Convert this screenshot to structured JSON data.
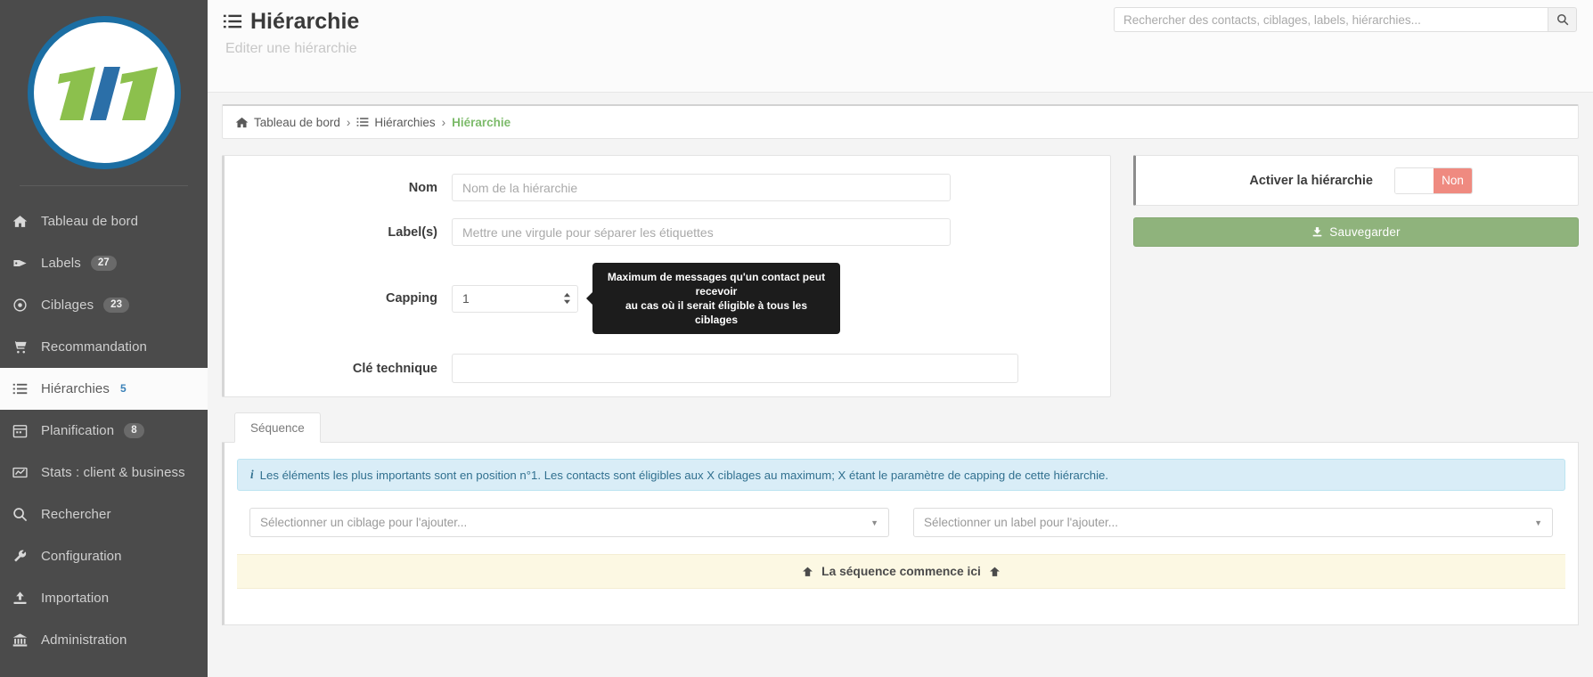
{
  "sidebar": {
    "logo": {
      "alt": "1|1 logo",
      "green": "#8cc04d",
      "blue": "#2b6fa8"
    },
    "items": [
      {
        "label": "Tableau de bord",
        "icon": "home-icon",
        "badge": null,
        "active": false
      },
      {
        "label": "Labels",
        "icon": "tag-icon",
        "badge": "27",
        "active": false
      },
      {
        "label": "Ciblages",
        "icon": "target-icon",
        "badge": "23",
        "active": false
      },
      {
        "label": "Recommandation",
        "icon": "cart-icon",
        "badge": null,
        "active": false
      },
      {
        "label": "Hiérarchies",
        "icon": "list-icon",
        "badge": "5",
        "active": true
      },
      {
        "label": "Planification",
        "icon": "calendar-icon",
        "badge": "8",
        "active": false
      },
      {
        "label": "Stats : client & business",
        "icon": "chart-icon",
        "badge": null,
        "active": false
      },
      {
        "label": "Rechercher",
        "icon": "search-icon",
        "badge": null,
        "active": false
      },
      {
        "label": "Configuration",
        "icon": "wrench-icon",
        "badge": null,
        "active": false
      },
      {
        "label": "Importation",
        "icon": "upload-icon",
        "badge": null,
        "active": false
      },
      {
        "label": "Administration",
        "icon": "bank-icon",
        "badge": null,
        "active": false
      }
    ]
  },
  "header": {
    "title": "Hiérarchie",
    "subtitle": "Editer une hiérarchie",
    "search_placeholder": "Rechercher des contacts, ciblages, labels, hiérarchies...",
    "search_value": ""
  },
  "breadcrumb": {
    "home": "Tableau de bord",
    "sep": "›",
    "section": "Hiérarchies",
    "current": "Hiérarchie"
  },
  "form": {
    "nom_label": "Nom",
    "nom_placeholder": "Nom de la hiérarchie",
    "nom_value": "",
    "labels_label": "Label(s)",
    "labels_placeholder": "Mettre une virgule pour séparer les étiquettes",
    "labels_value": "",
    "capping_label": "Capping",
    "capping_value": "1",
    "capping_tooltip_line1": "Maximum de messages qu'un contact peut recevoir",
    "capping_tooltip_line2": "au cas où il serait éligible à tous les ciblages",
    "key_label": "Clé technique",
    "key_value": "",
    "key_placeholder": ""
  },
  "activate": {
    "label": "Activer la hiérarchie",
    "state": "Non",
    "state_color": "#ef8a80"
  },
  "save": {
    "label": "Sauvegarder",
    "color": "#8fb37c"
  },
  "sequence": {
    "tab_label": "Séquence",
    "info": "Les éléments les plus importants sont en position n°1. Les contacts sont éligibles aux X ciblages au maximum; X étant le paramètre de capping de cette hiérarchie.",
    "info_icon": "i",
    "ciblage_select_placeholder": "Sélectionner un ciblage pour l'ajouter...",
    "label_select_placeholder": "Sélectionner un label pour l'ajouter...",
    "start_text": "La séquence commence ici",
    "start_icon": "⇧"
  }
}
